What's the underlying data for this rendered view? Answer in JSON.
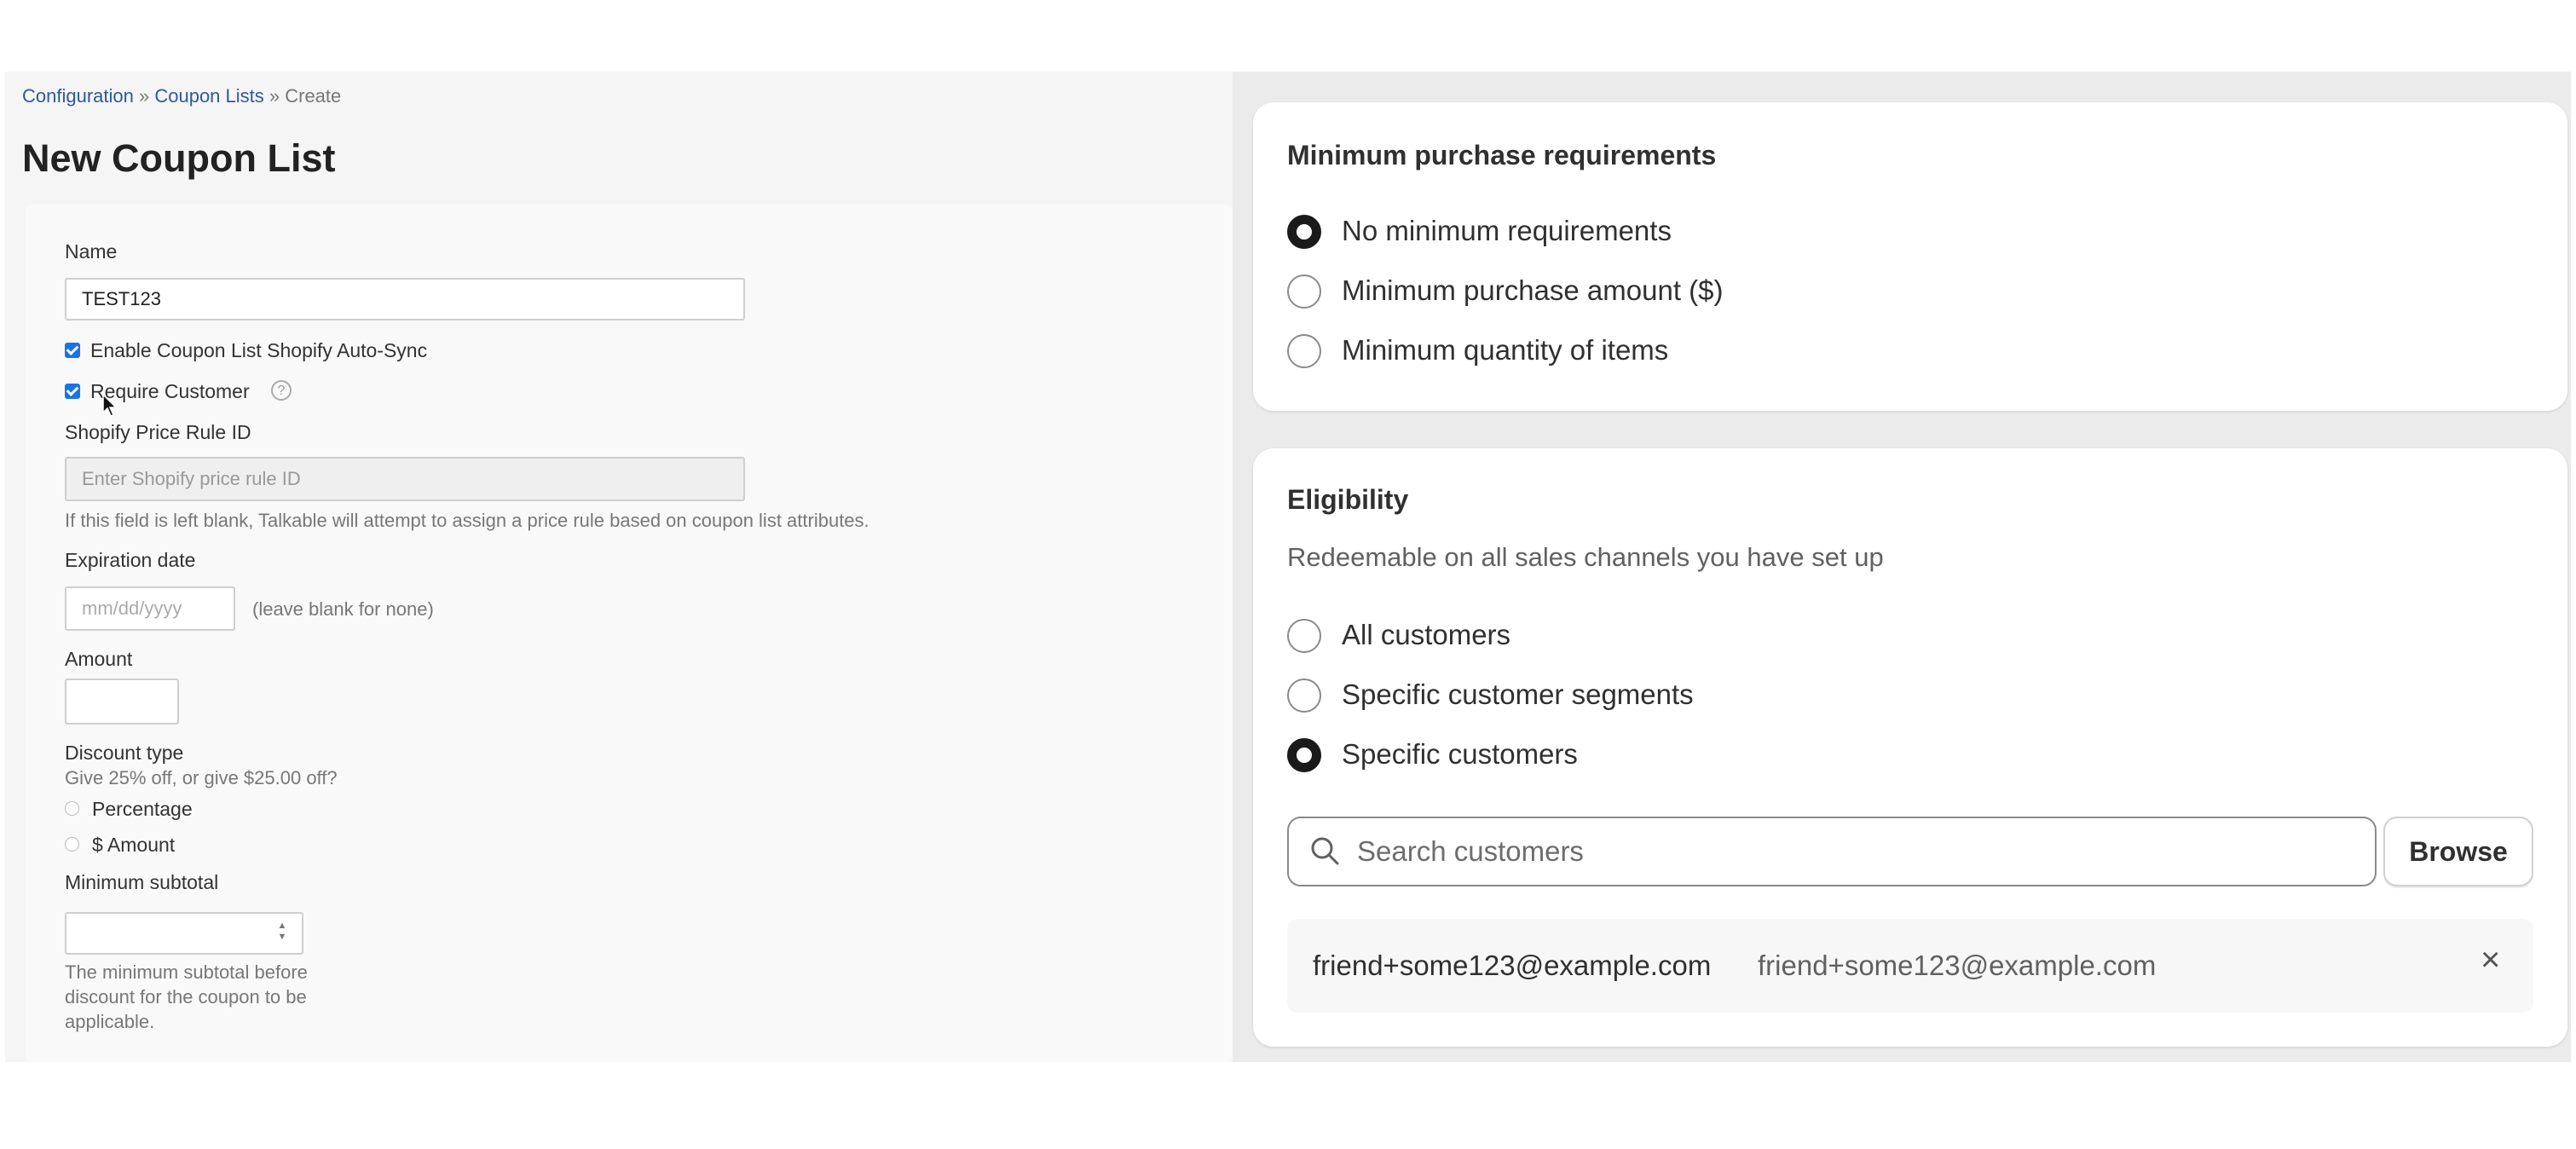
{
  "breadcrumb": {
    "item1": "Configuration",
    "sep1": " » ",
    "item2": "Coupon Lists",
    "sep2": " » ",
    "current": "Create"
  },
  "page_title": "New Coupon List",
  "form": {
    "name_label": "Name",
    "name_value": "TEST123",
    "autosync_label": "Enable Coupon List Shopify Auto-Sync",
    "autosync_checked": true,
    "require_customer_label": "Require Customer",
    "require_customer_checked": true,
    "help_icon": "?",
    "price_rule_label": "Shopify Price Rule ID",
    "price_rule_placeholder": "Enter Shopify price rule ID",
    "price_rule_hint": "If this field is left blank, Talkable will attempt to assign a price rule based on coupon list attributes.",
    "expiration_label": "Expiration date",
    "expiration_placeholder": "mm/dd/yyyy",
    "expiration_hint": "(leave blank for none)",
    "amount_label": "Amount",
    "amount_value": "",
    "discount_type_label": "Discount type",
    "discount_type_hint": "Give 25% off, or give $25.00 off?",
    "discount_options": [
      "Percentage",
      "$ Amount"
    ],
    "min_subtotal_label": "Minimum subtotal",
    "min_subtotal_value": "",
    "min_subtotal_hint_line1": "The minimum subtotal before",
    "min_subtotal_hint_line2": "discount for the coupon to be",
    "min_subtotal_hint_line3": "applicable."
  },
  "min_purchase": {
    "title": "Minimum purchase requirements",
    "options": [
      "No minimum requirements",
      "Minimum purchase amount ($)",
      "Minimum quantity of items"
    ],
    "selected": "No minimum requirements"
  },
  "eligibility": {
    "title": "Eligibility",
    "subtitle": "Redeemable on all sales channels you have set up",
    "options": [
      "All customers",
      "Specific customer segments",
      "Specific customers"
    ],
    "selected": "Specific customers",
    "search_placeholder": "Search customers",
    "browse_label": "Browse",
    "customer": {
      "name": "friend+some123@example.com",
      "email": "friend+some123@example.com",
      "remove_icon": "×"
    }
  },
  "colors": {
    "checkbox": "#1a73e8",
    "link": "#2d5a9b",
    "radio_selected": "#1a1a1a"
  }
}
